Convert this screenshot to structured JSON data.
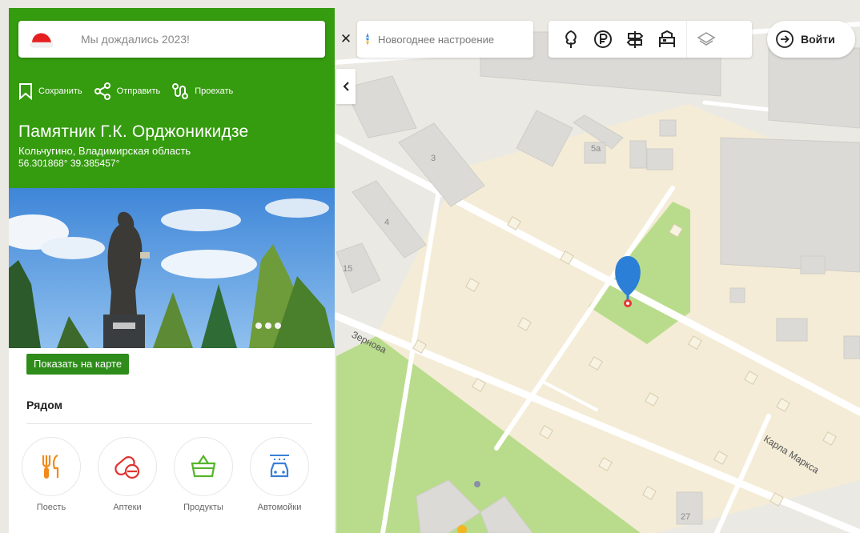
{
  "search": {
    "text": "Мы дождались 2023!"
  },
  "actions": {
    "save": "Сохранить",
    "share": "Отправить",
    "route": "Проехать"
  },
  "place": {
    "title": "Памятник Г.К. Орджоникидзе",
    "region": "Кольчугино, Владимирская область",
    "coords": "56.301868° 39.385457°"
  },
  "show_on_map": "Показать на карте",
  "nearby": {
    "title": "Рядом",
    "categories": [
      {
        "label": "Поесть",
        "icon": "fork-knife-icon",
        "color": "#f08a1c"
      },
      {
        "label": "Аптеки",
        "icon": "pill-icon",
        "color": "#e0332f"
      },
      {
        "label": "Продукты",
        "icon": "basket-icon",
        "color": "#56b42b"
      },
      {
        "label": "Автомойки",
        "icon": "car-wash-icon",
        "color": "#3a7fd8"
      }
    ]
  },
  "event_chip": {
    "label": "Новогоднее настроение"
  },
  "toolbar": {
    "tools": [
      {
        "icon": "tree-icon",
        "name": "tool-tree"
      },
      {
        "icon": "ruble-icon",
        "name": "tool-ruble"
      },
      {
        "icon": "signpost-icon",
        "name": "tool-signpost"
      },
      {
        "icon": "hotel-bed-icon",
        "name": "tool-hotel"
      },
      {
        "icon": "layers-icon",
        "name": "tool-layers"
      }
    ]
  },
  "login": {
    "label": "Войти"
  },
  "map": {
    "buildings": [
      "3",
      "4",
      "5a",
      "15",
      "27"
    ],
    "streets": {
      "zernova": "Зернова",
      "karla_marksa": "Карла Маркса"
    }
  },
  "colors": {
    "panel_green": "#359b0f",
    "marker_blue": "#2b7fd6",
    "park_green": "#b9dc8c",
    "block_beige": "#f4ecd6",
    "building_gray": "#dcdad6"
  }
}
